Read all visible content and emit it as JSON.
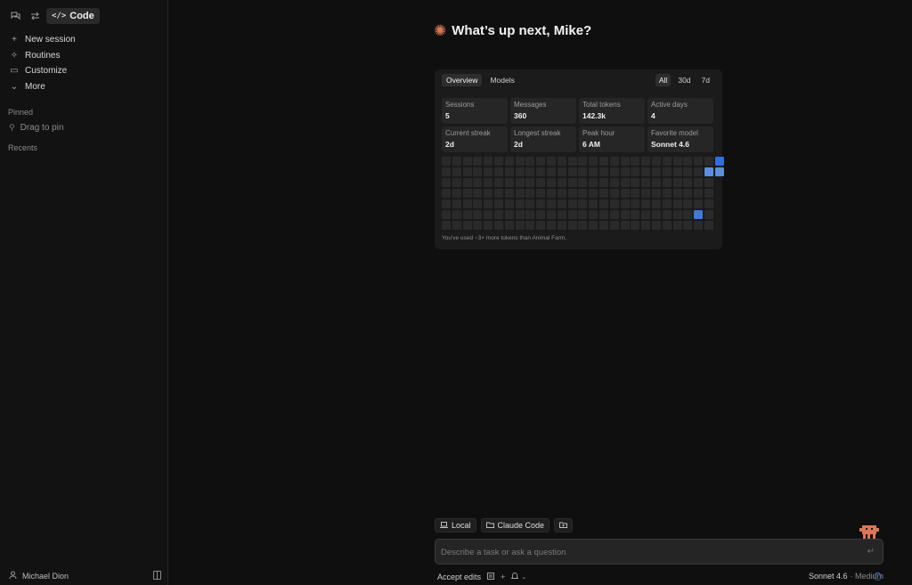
{
  "sidebar": {
    "top_icons": [
      "chat-bubble-icon",
      "swap-icon"
    ],
    "mode_button": {
      "icon": "code-brackets-icon",
      "label": "Code"
    },
    "nav": [
      {
        "icon": "plus-icon",
        "label": "New session"
      },
      {
        "icon": "routines-icon",
        "label": "Routines"
      },
      {
        "icon": "customize-icon",
        "label": "Customize"
      },
      {
        "icon": "chevron-down-icon",
        "label": "More"
      }
    ],
    "pinned_label": "Pinned",
    "pin_hint": {
      "icon": "pin-icon",
      "label": "Drag to pin"
    },
    "recents_label": "Recents",
    "user": {
      "icon": "user-icon",
      "name": "Michael Dion"
    }
  },
  "main": {
    "greeting": "What’s up next, Mike?",
    "accent_color": "#d97757"
  },
  "stats_panel": {
    "tabs": [
      "Overview",
      "Models"
    ],
    "active_tab": "Overview",
    "ranges": [
      "All",
      "30d",
      "7d"
    ],
    "active_range": "All",
    "stats": [
      {
        "label": "Sessions",
        "value": "5"
      },
      {
        "label": "Messages",
        "value": "360"
      },
      {
        "label": "Total tokens",
        "value": "142.3k"
      },
      {
        "label": "Active days",
        "value": "4"
      },
      {
        "label": "Current streak",
        "value": "2d"
      },
      {
        "label": "Longest streak",
        "value": "2d"
      },
      {
        "label": "Peak hour",
        "value": "6 AM"
      },
      {
        "label": "Favorite model",
        "value": "Sonnet 4.6"
      }
    ],
    "heatmap_active_color": "#3f7ad8",
    "heatmap_empty_color": "#2a2a2a",
    "footnote": "You've used ~3× more tokens than Animal Farm."
  },
  "composer": {
    "chips": [
      {
        "icon": "laptop-icon",
        "label": "Local"
      },
      {
        "icon": "folder-icon",
        "label": "Claude Code"
      },
      {
        "icon": "folder-plus-icon",
        "label": ""
      }
    ],
    "placeholder": "Describe a task or ask a question",
    "accept_edits": "Accept edits",
    "model": "Sonnet 4.6",
    "effort": "· Medium"
  }
}
